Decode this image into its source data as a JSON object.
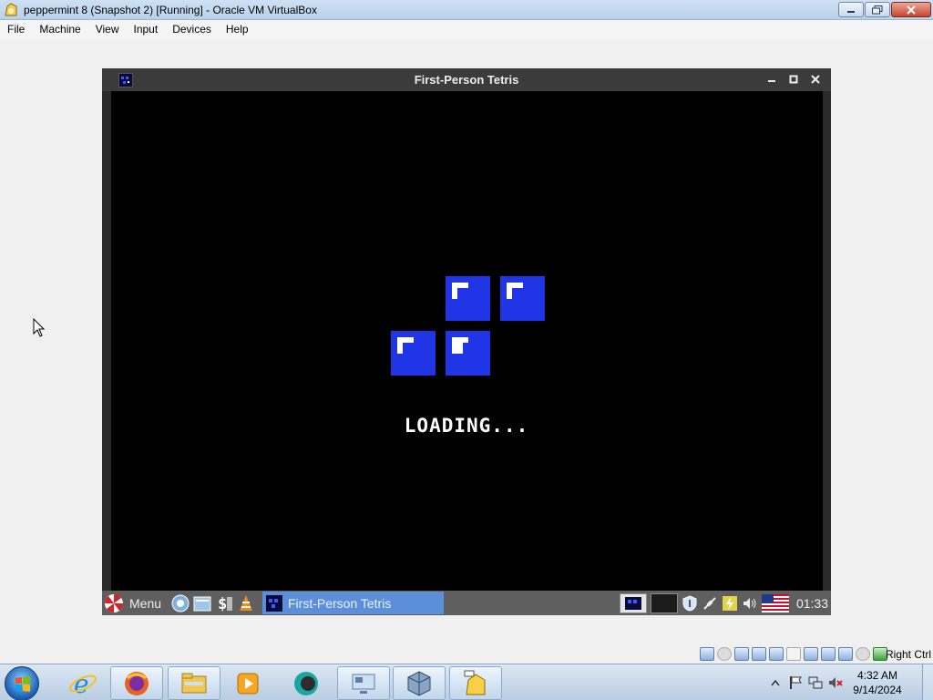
{
  "host_window": {
    "title": "peppermint 8 (Snapshot 2) [Running] - Oracle VM VirtualBox",
    "menu": [
      "File",
      "Machine",
      "View",
      "Input",
      "Devices",
      "Help"
    ],
    "host_key": "Right Ctrl"
  },
  "game_window": {
    "title": "First-Person Tetris",
    "loading_text": "LOADING...",
    "block_color": "#1f35e6"
  },
  "guest_panel": {
    "menu_label": "Menu",
    "task_label": "First-Person Tetris",
    "clock": "01:33",
    "task_color": "#5b8fd9"
  },
  "windows_taskbar": {
    "time": "4:32 AM",
    "date": "9/14/2024"
  },
  "icons": {
    "taskbar_pinned": [
      "internet-explorer-icon",
      "firefox-icon",
      "file-explorer-icon",
      "media-player-icon",
      "browser-icon",
      "remote-desktop-icon",
      "virtualbox-icon",
      "network-folder-icon"
    ],
    "tray": [
      "show-hidden-icons-chevron",
      "action-center-flag-icon",
      "network-icon",
      "volume-muted-icon"
    ]
  }
}
